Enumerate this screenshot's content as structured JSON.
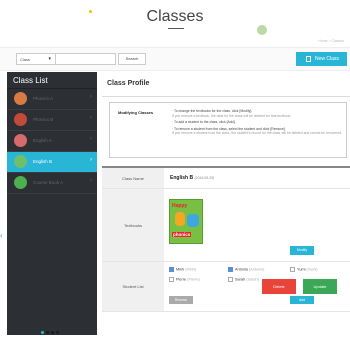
{
  "header": {
    "title": "Classes",
    "breadcrumb": "Home > Classes"
  },
  "toolbar": {
    "select_value": "Class",
    "search_label": "Search",
    "new_class_label": "New Class"
  },
  "sidebar": {
    "title": "Class List",
    "items": [
      {
        "label": "Phonics A",
        "active": false
      },
      {
        "label": "Phonics B",
        "active": false
      },
      {
        "label": "English A",
        "active": false
      },
      {
        "label": "English B",
        "active": true
      },
      {
        "label": "Course Book A",
        "active": false
      }
    ]
  },
  "main": {
    "title": "Class Profile",
    "info": {
      "label": "Modifying Classes",
      "lines": [
        "To change the textbooks for the class, click [Modify].",
        "If you remove a textbook, the data for the class will be deleted for that textbook.",
        "To add a student to the class, click [Add].",
        "To remove a student from the class, select the student and click [Remove].",
        "If you remove a student from the class, the student's record for the class will be deleted and cannot be recovered."
      ]
    },
    "class_name_header": "Class Name",
    "class_name": "English B",
    "class_date": "(2016.05.25)",
    "textbooks_header": "Textbooks",
    "book_title": "Happy",
    "book_sub": "phonics",
    "modify_label": "Modify",
    "student_list_header": "Student List",
    "students": [
      {
        "name": "Minh",
        "sub": "(Minh)",
        "checked": true
      },
      {
        "name": "Antonia",
        "sub": "(Antonio)",
        "checked": true
      },
      {
        "name": "Yumi",
        "sub": "(Yumi)",
        "checked": false
      },
      {
        "name": "Pierre",
        "sub": "(Pierre)",
        "checked": false
      },
      {
        "name": "Sarah",
        "sub": "(Sarah)",
        "checked": false
      }
    ],
    "remove_label": "Remove",
    "add_label": "Add",
    "delete_label": "Delete",
    "update_label": "Update"
  },
  "colors": {
    "accent": "#29b6d6",
    "delete": "#e8443a",
    "update": "#3aa857",
    "sidebar_bg": "#2c2f33"
  }
}
